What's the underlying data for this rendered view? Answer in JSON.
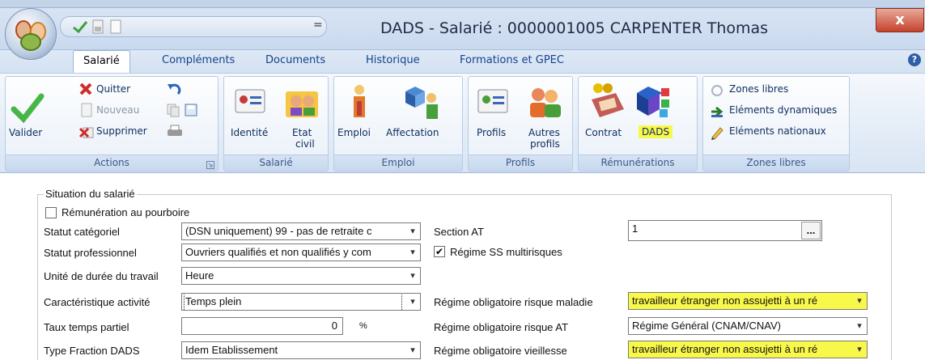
{
  "window": {
    "title": "DADS - Salarié : 0000001005 CARPENTER Thomas",
    "close_label": "x",
    "qat_dropdown": "="
  },
  "tabs": [
    {
      "label": "Salarié",
      "active": true
    },
    {
      "label": "Compléments"
    },
    {
      "label": "Documents"
    },
    {
      "label": "Historique"
    },
    {
      "label": "Formations et GPEC"
    }
  ],
  "help_label": "?",
  "ribbon": {
    "actions": {
      "label": "Actions",
      "valider": "Valider",
      "quitter": "Quitter",
      "nouveau": "Nouveau",
      "supprimer": "Supprimer"
    },
    "salarie": {
      "label": "Salarié",
      "identite": "Identité",
      "etat_civil_1": "Etat",
      "etat_civil_2": "civil"
    },
    "emploi": {
      "label": "Emploi",
      "emploi": "Emploi",
      "affectation": "Affectation"
    },
    "profils": {
      "label": "Profils",
      "profils": "Profils",
      "autres_1": "Autres",
      "autres_2": "profils"
    },
    "remunerations": {
      "label": "Rémunérations",
      "contrat": "Contrat",
      "dads": "DADS"
    },
    "zones": {
      "label": "Zones libres",
      "zones_libres": "Zones libres",
      "elements_dynamiques": "Eléments dynamiques",
      "elements_nationaux": "Eléments nationaux"
    }
  },
  "form": {
    "fieldset_legend": "Situation du salarié",
    "remuneration_pourboire": {
      "label": "Rémunération au pourboire",
      "checked": false
    },
    "statut_categoriel": {
      "label": "Statut catégoriel",
      "value": "(DSN uniquement) 99 - pas de retraite c"
    },
    "statut_professionnel": {
      "label": "Statut professionnel",
      "value": "Ouvriers qualifiés et non qualifiés y com"
    },
    "unite_duree": {
      "label": "Unité de durée du travail",
      "value": "Heure"
    },
    "caracteristique_activite": {
      "label": "Caractéristique activité",
      "value": "Temps plein"
    },
    "taux_temps_partiel": {
      "label": "Taux temps partiel",
      "value": "0",
      "unit": "%"
    },
    "type_fraction": {
      "label": "Type Fraction DADS",
      "value": "Idem Etablissement"
    },
    "section_at": {
      "label": "Section AT",
      "value": "1",
      "button": "..."
    },
    "regime_ss": {
      "label": "Régime SS multirisques",
      "checked": true
    },
    "regime_maladie": {
      "label": "Régime obligatoire risque maladie",
      "value": "travailleur étranger non assujetti à un ré"
    },
    "regime_at": {
      "label": "Régime obligatoire risque AT",
      "value": "Régime Général (CNAM/CNAV)"
    },
    "regime_vieillesse": {
      "label": "Régime obligatoire vieillesse",
      "value": "travailleur étranger non assujetti à un ré"
    }
  },
  "colors": {
    "highlight": "#f8f84a",
    "ribbon_text": "#0f2e60"
  }
}
